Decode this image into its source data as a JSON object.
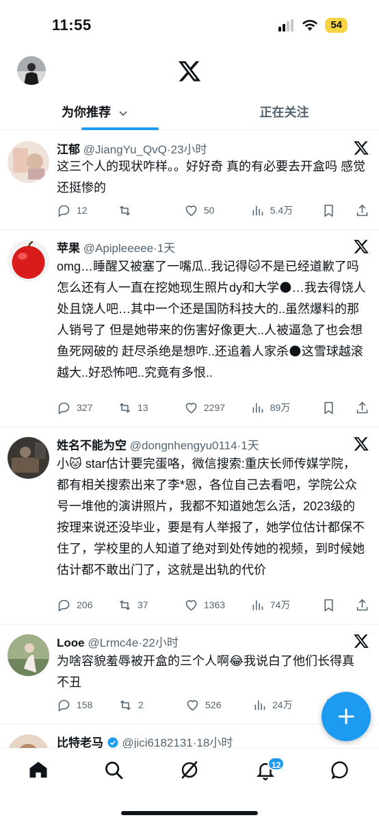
{
  "status_bar": {
    "time": "11:55",
    "battery": "54"
  },
  "header": {
    "logo": "x-logo-icon"
  },
  "tabs": [
    {
      "label": "为你推荐",
      "active": true
    },
    {
      "label": "正在关注",
      "active": false
    }
  ],
  "tweets": [
    {
      "name": "江郁",
      "handle": "@JiangYu_QvQ",
      "time": "23小时",
      "text": "这三个人的现状咋样。。好好奇 真的有必要去开盒吗 感觉还挺惨的",
      "replies": "12",
      "retweets": "",
      "likes": "50",
      "views": "5.4万"
    },
    {
      "name": "苹果",
      "handle": "@Apipleeeee",
      "time": "1天",
      "text": "omg…睡醒又被塞了一嘴瓜..我记得🐱不是已经道歉了吗 怎么还有人一直在挖她现生照片dy和大学🌑…我去得饶人处且饶人吧…其中一个还是国防科技大的..虽然爆料的那人销号了 但是她带来的伤害好像更大..人被逼急了也会想鱼死网破的 赶尽杀绝是想咋..还追着人家杀🌑这雪球越滚越大..好恐怖吧..究竟有多恨..",
      "replies": "327",
      "retweets": "13",
      "likes": "2297",
      "views": "89万"
    },
    {
      "name": "姓名不能为空",
      "handle": "@dongnhengyu0114",
      "time": "1天",
      "text": "小🐱 star估计要完蛋咯，微信搜索:重庆长师传媒学院，都有相关搜索出来了李*恩，各位自己去看吧，学院公众号一堆他的演讲照片，我都不知道她怎么活，2023级的按理来说还没毕业，要是有人举报了，她学位估计都保不住了，学校里的人知道了绝对到处传她的视频，到时候她估计都不敢出门了，这就是出轨的代价",
      "replies": "206",
      "retweets": "37",
      "likes": "1363",
      "views": "74万"
    },
    {
      "name": "Looe",
      "handle": "@Lrmc4e",
      "time": "22小时",
      "text": "为啥容貌羞辱被开盒的三个人啊😂我说白了他们长得真不丑",
      "replies": "158",
      "retweets": "2",
      "likes": "526",
      "views": "24万"
    },
    {
      "name": "比特老马",
      "handle": "@jici6182131",
      "time": "18小时"
    }
  ],
  "notifications_badge": "12",
  "colors": {
    "accent": "#1d9bf0",
    "text": "#0f1419",
    "muted": "#536471"
  }
}
